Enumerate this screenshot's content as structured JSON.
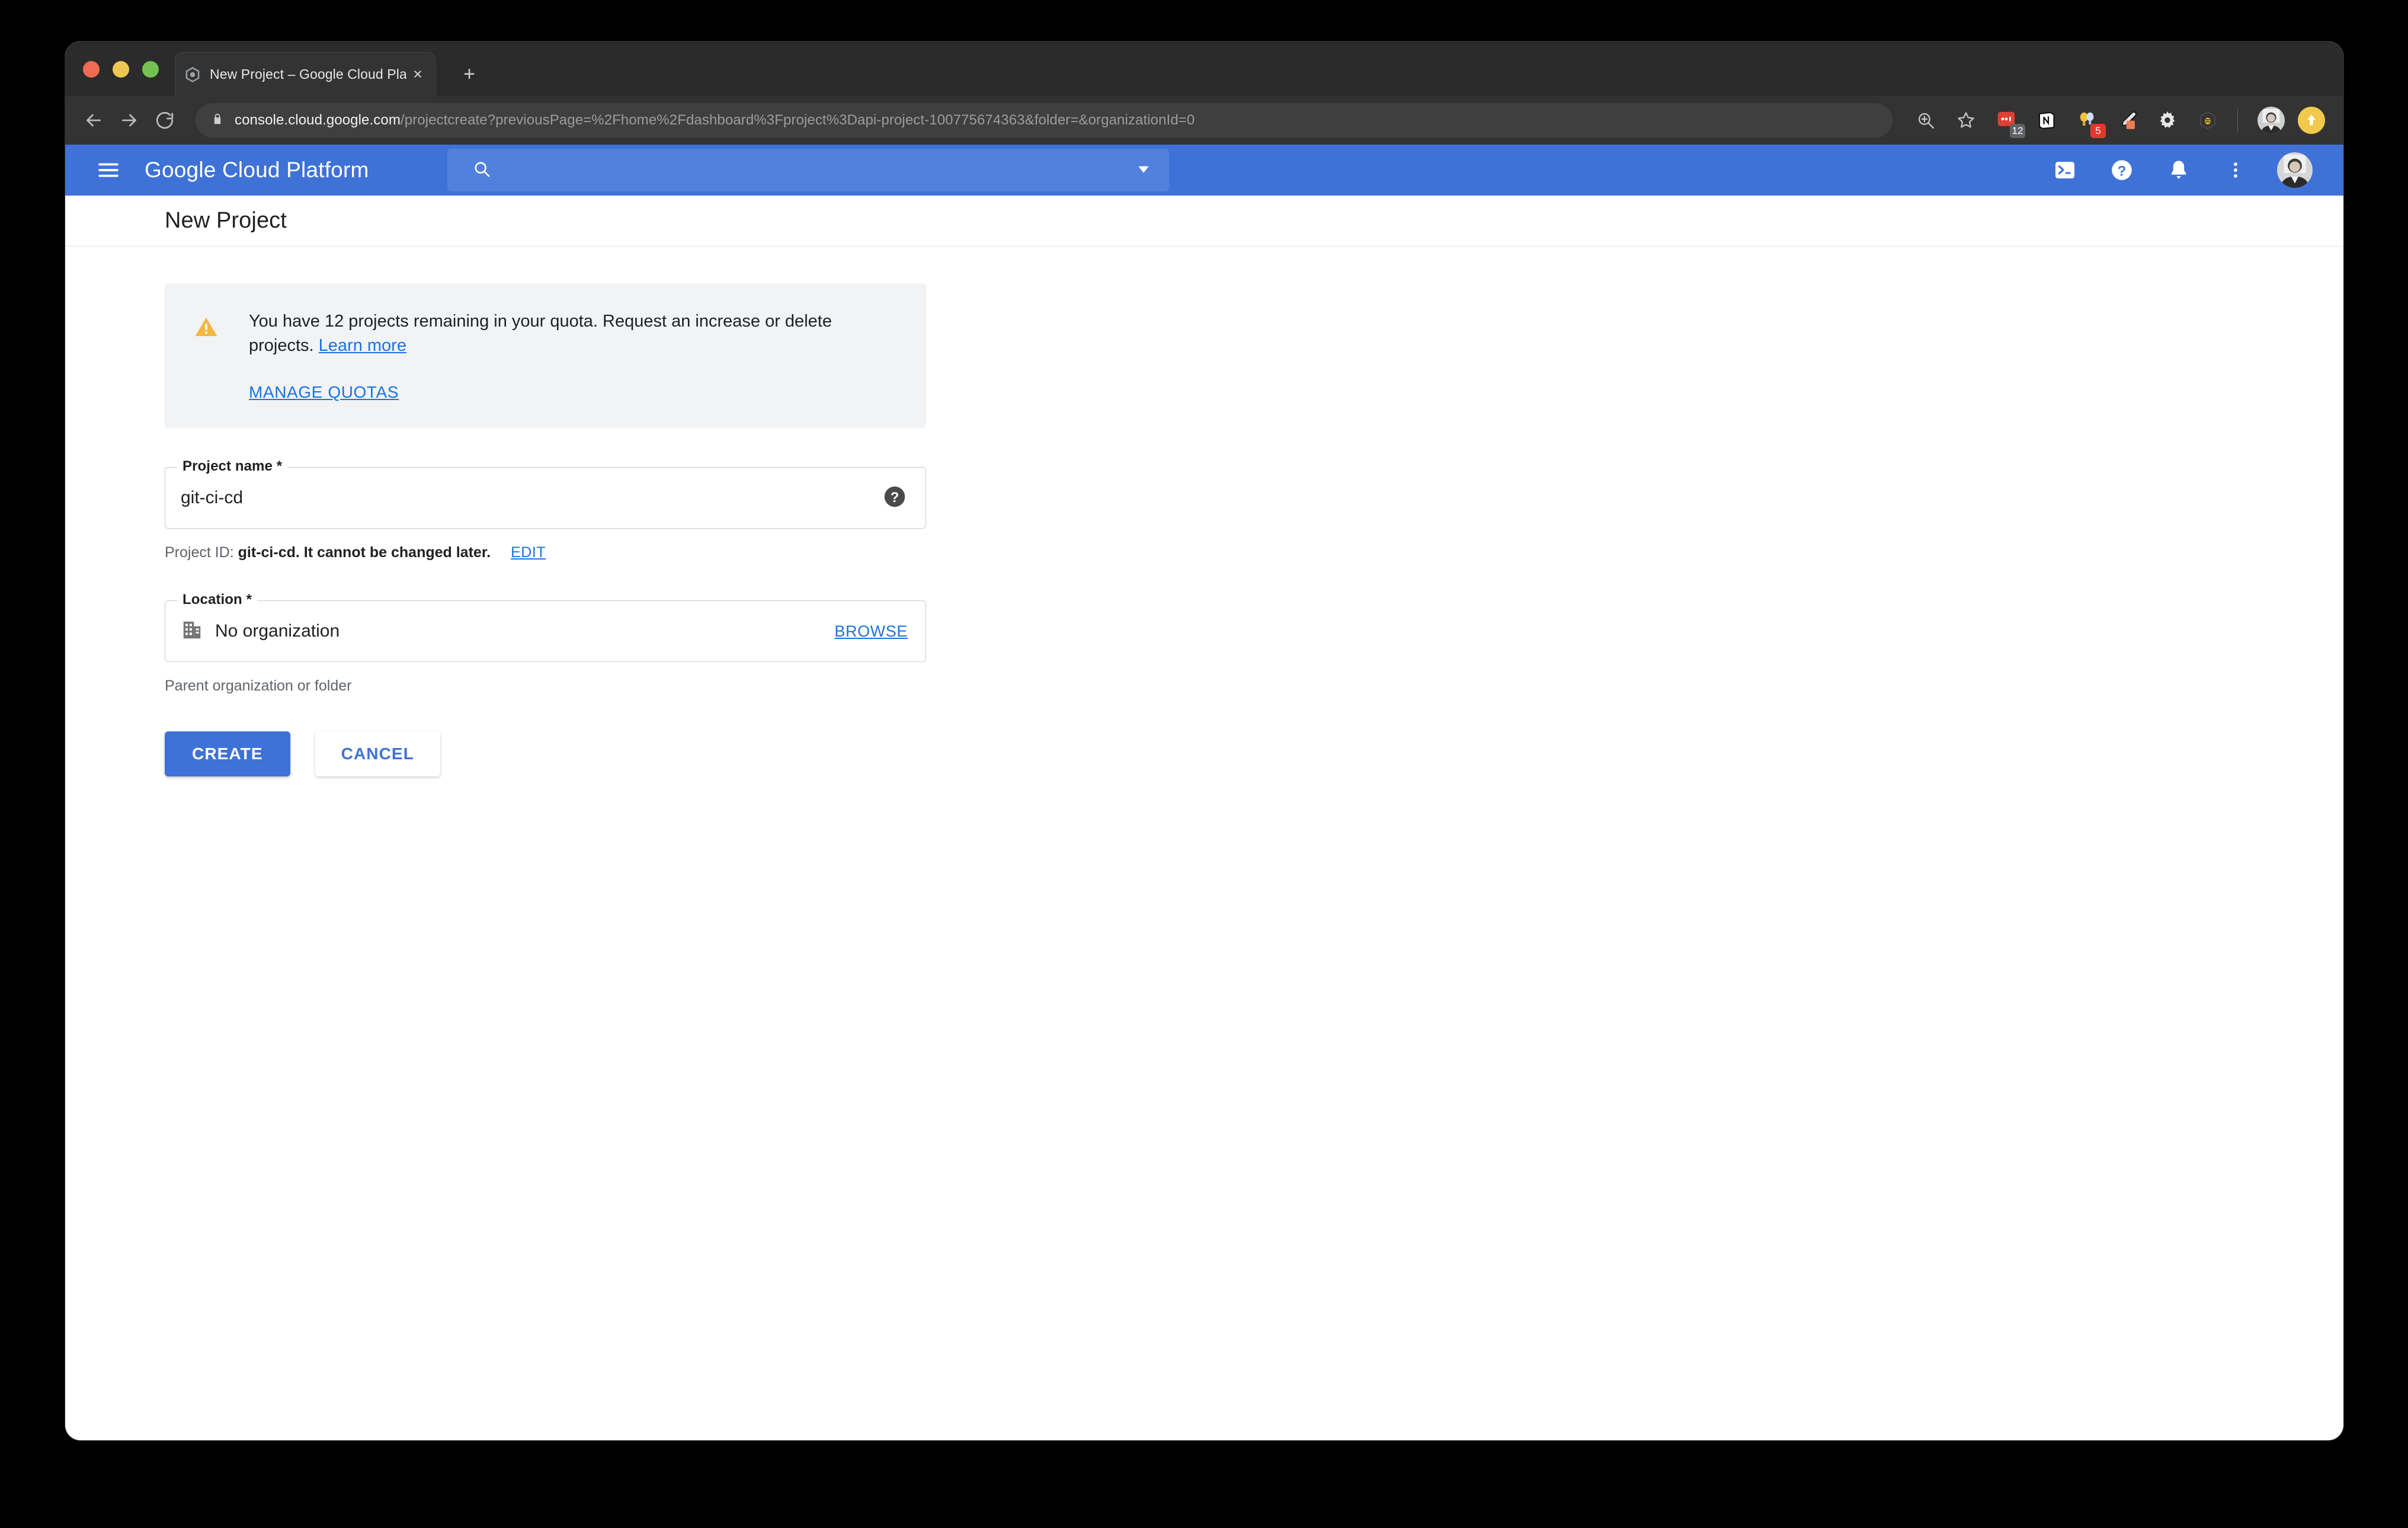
{
  "browser": {
    "tab": {
      "title": "New Project – Google Cloud Plat",
      "favicon": "gcp-hexagon-icon",
      "close_label": "×"
    },
    "new_tab_label": "+",
    "nav": {
      "back": "back-arrow-icon",
      "forward": "forward-arrow-icon",
      "reload": "reload-icon"
    },
    "omnibox": {
      "lock": "lock-icon",
      "host": "console.cloud.google.com",
      "path": "/projectcreate?previousPage=%2Fhome%2Fdashboard%3Fproject%3Dapi-project-100775674363&folder=&organizationId=0"
    },
    "toolbar_icons": [
      {
        "name": "zoom-icon",
        "badge": ""
      },
      {
        "name": "bookmark-star-icon",
        "badge": ""
      },
      {
        "name": "red-chat-extension-icon",
        "badge": "12"
      },
      {
        "name": "notion-extension-icon",
        "badge": ""
      },
      {
        "name": "lightbulbs-extension-icon",
        "badge": "5"
      },
      {
        "name": "eyedropper-extension-icon",
        "badge": ""
      },
      {
        "name": "gear-extension-icon",
        "badge": ""
      },
      {
        "name": "bee-extension-icon",
        "badge": ""
      }
    ]
  },
  "gcp_header": {
    "menu_label": "hamburger-menu-icon",
    "product_name": "Google Cloud Platform",
    "search": {
      "value": "",
      "placeholder": "",
      "icon": "search-icon",
      "dropdown": "chevron-down-icon"
    },
    "actions": [
      {
        "name": "cloud-shell-icon"
      },
      {
        "name": "help-icon"
      },
      {
        "name": "notifications-bell-icon"
      },
      {
        "name": "more-vert-icon"
      }
    ],
    "avatar": "user-avatar"
  },
  "page": {
    "title": "New Project",
    "quota_notice": {
      "icon": "warning-triangle-icon",
      "text_before_link": "You have 12 projects remaining in your quota. Request an increase or delete projects.",
      "learn_more_label": "Learn more",
      "manage_quotas_label": "MANAGE QUOTAS",
      "projects_remaining": 12
    },
    "project_name_field": {
      "label": "Project name *",
      "value": "git-ci-cd",
      "help_icon": "help-circle-icon"
    },
    "project_id_hint": {
      "prefix": "Project ID:",
      "id": "git-ci-cd",
      "suffix": ". It cannot be changed later.",
      "edit_label": "EDIT"
    },
    "location_field": {
      "label": "Location *",
      "icon": "organization-building-icon",
      "value": "No organization",
      "browse_label": "BROWSE"
    },
    "location_hint": "Parent organization or folder",
    "buttons": {
      "create_label": "CREATE",
      "cancel_label": "CANCEL"
    }
  },
  "colors": {
    "gcp_blue": "#3f72d7",
    "link_blue": "#1a73e8",
    "warning_amber": "#f4b73f",
    "card_gray": "#f1f3f4",
    "chrome_dark": "#333333"
  }
}
